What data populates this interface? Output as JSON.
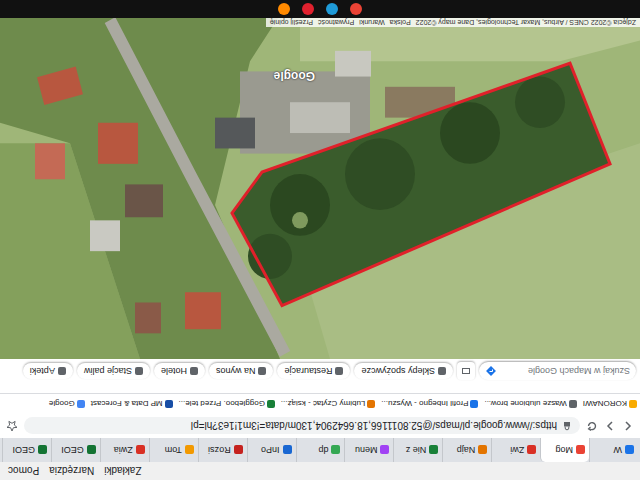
{
  "menu": [
    "Zakładki",
    "Narzędzia",
    "Pomoc"
  ],
  "tabs": [
    {
      "label": "W",
      "selected": false,
      "color": "#1a73e8"
    },
    {
      "label": "Mog",
      "selected": true,
      "color": "#ea4335"
    },
    {
      "label": "Zwi",
      "selected": false,
      "color": "#d93025"
    },
    {
      "label": "Najp",
      "selected": false,
      "color": "#e37400"
    },
    {
      "label": "Nie z",
      "selected": false,
      "color": "#188038"
    },
    {
      "label": "Menu",
      "selected": false,
      "color": "#a142f4"
    },
    {
      "label": "dp",
      "selected": false,
      "color": "#34a853"
    },
    {
      "label": "InPo",
      "selected": false,
      "color": "#1967d2"
    },
    {
      "label": "Rozsi",
      "selected": false,
      "color": "#c5221f"
    },
    {
      "label": "Tom",
      "selected": false,
      "color": "#f29900"
    },
    {
      "label": "Zwia",
      "selected": false,
      "color": "#d93025"
    },
    {
      "label": "GEOI",
      "selected": false,
      "color": "#137333"
    },
    {
      "label": "GEOI",
      "selected": false,
      "color": "#137333"
    }
  ],
  "url": "https://www.google.pl/maps/@52.8011166,18.6642904,130m/data=!3m1!1e3?hl=pl",
  "bookmarks": [
    {
      "label": "KORONAWI",
      "color": "#f9ab00"
    },
    {
      "label": "Wasze ulubione brow...",
      "color": "#5f6368"
    },
    {
      "label": "Profil Inbegno - Wyszu...",
      "color": "#1a73e8"
    },
    {
      "label": "Lubimy Czytać - książ...",
      "color": "#e37400"
    },
    {
      "label": "Goggleboo. Przed tele...",
      "color": "#188038"
    },
    {
      "label": "MP Data & Forecast",
      "color": "#174ea6"
    },
    {
      "label": "Google",
      "color": "#4285f4"
    }
  ],
  "search": {
    "placeholder": "Szukaj w Mapach Google"
  },
  "chips": [
    "Sklepy spożywcze",
    "Restauracje",
    "Na wynos",
    "Hotele",
    "Stacje paliw",
    "Apteki"
  ],
  "map": {
    "watermark": "Google",
    "attribution": "Zdjęcia ©2022 CNES / Airbus, Maxar Technologies, Dane mapy ©2022",
    "links": [
      "Polska",
      "Warunki",
      "Prywatność",
      "Prześlij opinię"
    ]
  },
  "taskbar": [
    {
      "color": "#ea4335"
    },
    {
      "color": "#1f9bd8"
    },
    {
      "color": "#e0212e"
    },
    {
      "color": "#ff8a00"
    }
  ]
}
